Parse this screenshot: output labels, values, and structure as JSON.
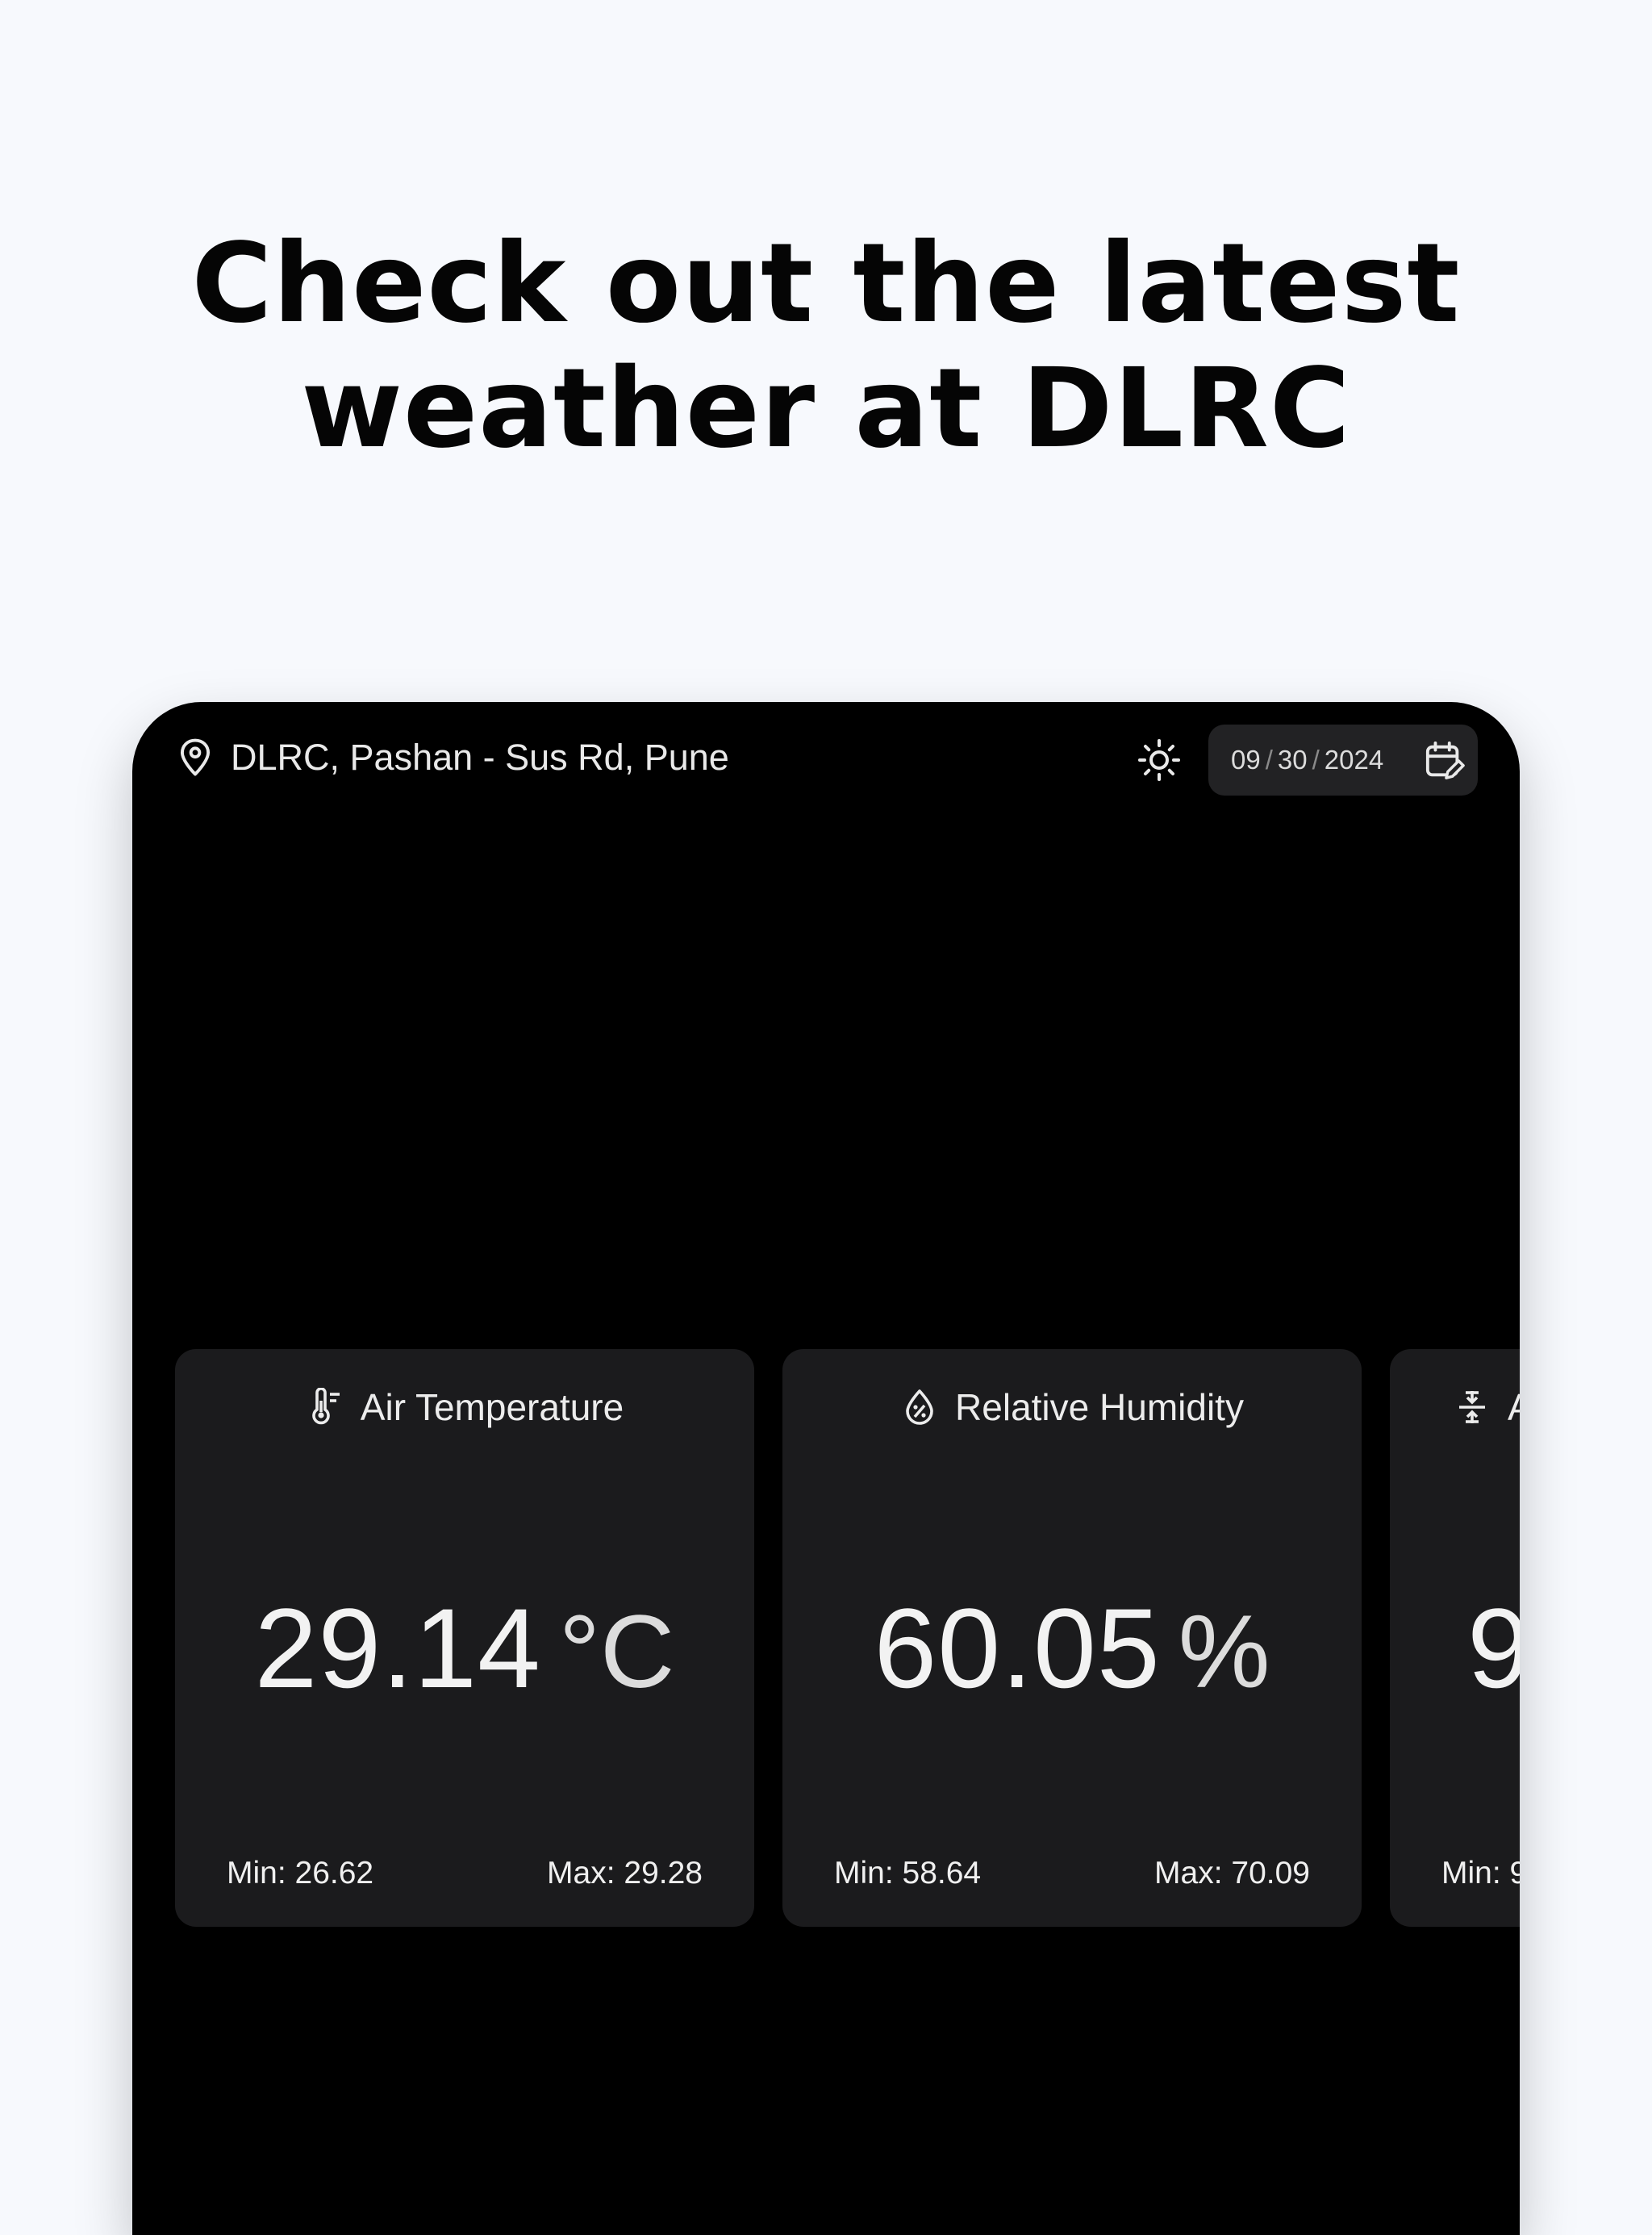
{
  "headline": {
    "line1": "Check out the latest",
    "line2": "weather at DLRC"
  },
  "topbar": {
    "location": "DLRC, Pashan - Sus Rd, Pune",
    "date": {
      "month": "09",
      "day": "30",
      "year": "2024",
      "separator": "/"
    }
  },
  "cards": [
    {
      "title": "Air Temperature",
      "value": "29.14",
      "unit": "°C",
      "min": "Min: 26.62",
      "max": "Max: 29.28",
      "icon": "thermometer-icon"
    },
    {
      "title": "Relative Humidity",
      "value": "60.05",
      "unit": "%",
      "min": "Min: 58.64",
      "max": "Max: 70.09",
      "icon": "humidity-drop-icon"
    },
    {
      "title": "A",
      "value": "9",
      "unit": "",
      "min": "Min: 9",
      "max": "",
      "icon": "pressure-icon"
    }
  ],
  "colors": {
    "page_bg": "#f7f9fd",
    "device_bg": "#000000",
    "card_bg": "#1b1b1d",
    "date_bg": "#222224"
  }
}
